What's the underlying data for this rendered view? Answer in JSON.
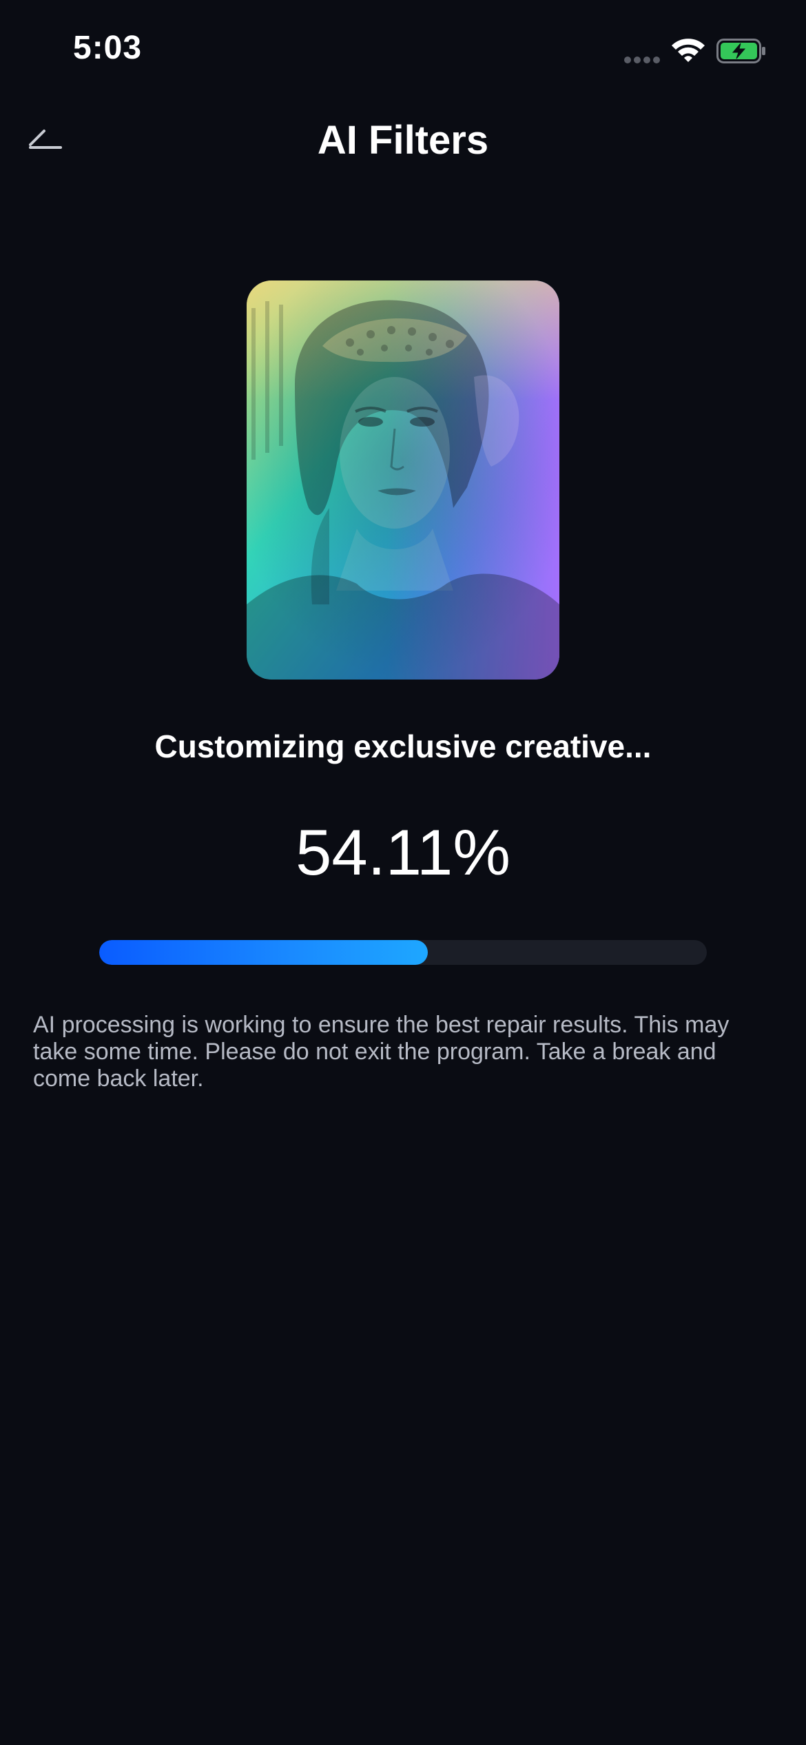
{
  "status_bar": {
    "time": "5:03",
    "battery_color": "#34c759"
  },
  "nav": {
    "title": "AI Filters",
    "back_icon": "back-arrow-icon"
  },
  "preview": {
    "gradient_colors": [
      "#e8e06a",
      "#22d3c5",
      "#2a9bff",
      "#b06cff"
    ],
    "image_icon": "portrait-photo"
  },
  "processing": {
    "title": "Customizing exclusive creative...",
    "percent_label": "54.11%",
    "progress": 54.11,
    "bar_colors": [
      "#0a5cff",
      "#1ea7ff"
    ],
    "track_color": "#1b1e27",
    "description": "AI processing is working to ensure the best repair results. This may take some time. Please do not exit the program. Take a break and come back later."
  }
}
